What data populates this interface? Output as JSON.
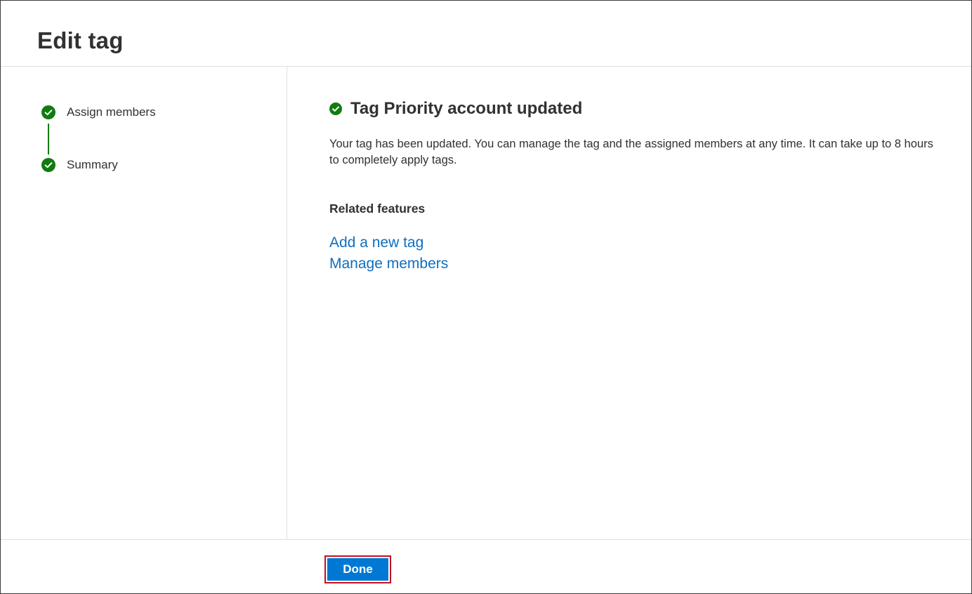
{
  "header": {
    "title": "Edit tag"
  },
  "steps": [
    {
      "label": "Assign members",
      "status": "complete",
      "icon": "check-circle-icon"
    },
    {
      "label": "Summary",
      "status": "complete",
      "icon": "check-circle-icon"
    }
  ],
  "main": {
    "success_icon": "check-circle-icon",
    "success_title": "Tag Priority account updated",
    "description": "Your tag has been updated. You can manage the tag and the assigned members at any time. It can take up to 8 hours to completely apply tags.",
    "related_heading": "Related features",
    "links": [
      {
        "label": "Add a new tag"
      },
      {
        "label": "Manage members"
      }
    ]
  },
  "footer": {
    "done_label": "Done"
  },
  "colors": {
    "success_green": "#107c10",
    "link_blue": "#106ebe",
    "primary_button": "#0078d4",
    "highlight_border": "#c50f1f"
  }
}
